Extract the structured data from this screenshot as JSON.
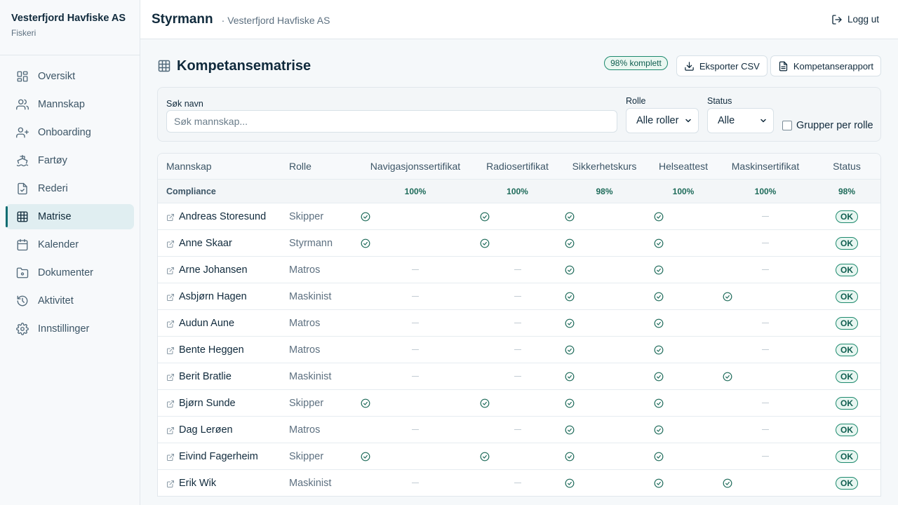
{
  "org": {
    "name": "Vesterfjord Havfiske AS",
    "type": "Fiskeri"
  },
  "nav": [
    {
      "label": "Oversikt",
      "icon": "dashboard-icon",
      "active": false
    },
    {
      "label": "Mannskap",
      "icon": "users-icon",
      "active": false
    },
    {
      "label": "Onboarding",
      "icon": "user-plus-icon",
      "active": false
    },
    {
      "label": "Fartøy",
      "icon": "ship-icon",
      "active": false
    },
    {
      "label": "Rederi",
      "icon": "document-check-icon",
      "active": false
    },
    {
      "label": "Matrise",
      "icon": "grid-icon",
      "active": true
    },
    {
      "label": "Kalender",
      "icon": "calendar-icon",
      "active": false
    },
    {
      "label": "Dokumenter",
      "icon": "folder-icon",
      "active": false
    },
    {
      "label": "Aktivitet",
      "icon": "history-icon",
      "active": false
    },
    {
      "label": "Innstillinger",
      "icon": "gear-icon",
      "active": false
    }
  ],
  "topbar": {
    "title": "Styrmann",
    "subtitle": "· Vesterfjord Havfiske AS",
    "logout": "Logg ut"
  },
  "page": {
    "title": "Kompetansematrise",
    "complete_badge": "98% komplett",
    "export_csv": "Eksporter CSV",
    "report": "Kompetanserapport"
  },
  "filters": {
    "search_label": "Søk navn",
    "search_placeholder": "Søk mannskap...",
    "role_label": "Rolle",
    "role_value": "Alle roller",
    "status_label": "Status",
    "status_value": "Alle",
    "group_label": "Grupper per rolle",
    "group_checked": false
  },
  "table": {
    "columns": [
      "Mannskap",
      "Rolle",
      "Navigasjonssertifikat",
      "Radiosertifikat",
      "Sikkerhetskurs",
      "Helseattest",
      "Maskinsertifikat",
      "Status"
    ],
    "compliance_label": "Compliance",
    "compliance": [
      "100%",
      "100%",
      "98%",
      "100%",
      "100%",
      "98%"
    ],
    "rows": [
      {
        "name": "Andreas Storesund",
        "role": "Skipper",
        "certs": [
          true,
          true,
          true,
          true,
          false
        ],
        "status": "OK"
      },
      {
        "name": "Anne Skaar",
        "role": "Styrmann",
        "certs": [
          true,
          true,
          true,
          true,
          false
        ],
        "status": "OK"
      },
      {
        "name": "Arne Johansen",
        "role": "Matros",
        "certs": [
          false,
          false,
          true,
          true,
          false
        ],
        "status": "OK"
      },
      {
        "name": "Asbjørn Hagen",
        "role": "Maskinist",
        "certs": [
          false,
          false,
          true,
          true,
          true
        ],
        "status": "OK"
      },
      {
        "name": "Audun Aune",
        "role": "Matros",
        "certs": [
          false,
          false,
          true,
          true,
          false
        ],
        "status": "OK"
      },
      {
        "name": "Bente Heggen",
        "role": "Matros",
        "certs": [
          false,
          false,
          true,
          true,
          false
        ],
        "status": "OK"
      },
      {
        "name": "Berit Bratlie",
        "role": "Maskinist",
        "certs": [
          false,
          false,
          true,
          true,
          true
        ],
        "status": "OK"
      },
      {
        "name": "Bjørn Sunde",
        "role": "Skipper",
        "certs": [
          true,
          true,
          true,
          true,
          false
        ],
        "status": "OK"
      },
      {
        "name": "Dag Lerøen",
        "role": "Matros",
        "certs": [
          false,
          false,
          true,
          true,
          false
        ],
        "status": "OK"
      },
      {
        "name": "Eivind Fagerheim",
        "role": "Skipper",
        "certs": [
          true,
          true,
          true,
          true,
          false
        ],
        "status": "OK"
      },
      {
        "name": "Erik Wik",
        "role": "Maskinist",
        "certs": [
          false,
          false,
          true,
          true,
          true
        ],
        "status": "OK"
      }
    ]
  }
}
